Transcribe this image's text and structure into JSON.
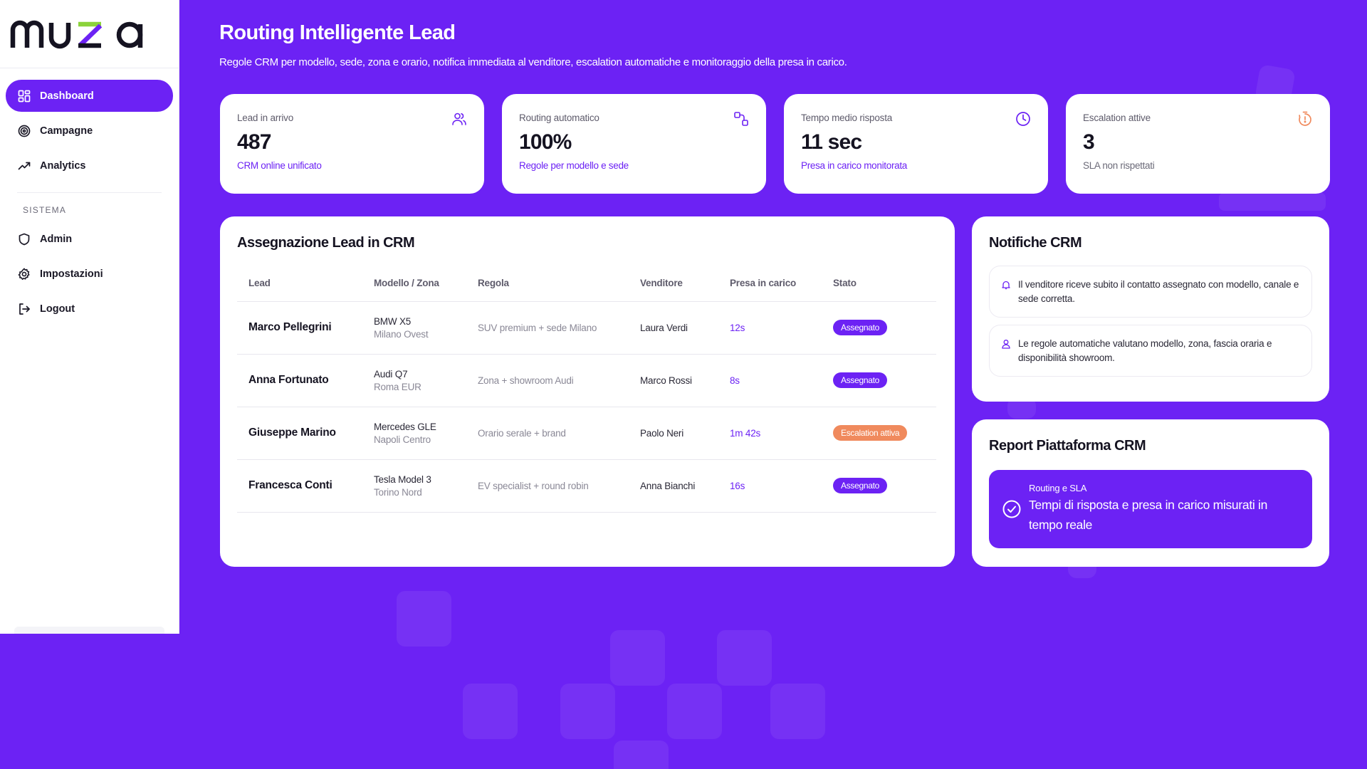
{
  "brand": {
    "name": "muza",
    "primary": "#6c22f4",
    "accent_green": "#8bd33a",
    "warning": "#f08a5d"
  },
  "sidebar": {
    "items": [
      {
        "label": "Dashboard",
        "icon": "grid-icon",
        "active": true
      },
      {
        "label": "Campagne",
        "icon": "target-icon",
        "active": false
      },
      {
        "label": "Analytics",
        "icon": "trend-icon",
        "active": false
      }
    ],
    "section_label": "SISTEMA",
    "system_items": [
      {
        "label": "Admin",
        "icon": "shield-icon"
      },
      {
        "label": "Impostazioni",
        "icon": "gear-icon"
      },
      {
        "label": "Logout",
        "icon": "logout-icon"
      }
    ]
  },
  "header": {
    "title": "Routing Intelligente Lead",
    "subtitle": "Regole CRM per modello, sede, zona e orario, notifica immediata al venditore, escalation automatiche e monitoraggio della presa in carico."
  },
  "stats": [
    {
      "label": "Lead in arrivo",
      "value": "487",
      "sub": "CRM online unificato",
      "icon": "users-icon"
    },
    {
      "label": "Routing automatico",
      "value": "100%",
      "sub": "Regole per modello e sede",
      "icon": "route-icon"
    },
    {
      "label": "Tempo medio risposta",
      "value": "11 sec",
      "sub": "Presa in carico monitorata",
      "icon": "clock-icon"
    },
    {
      "label": "Escalation attive",
      "value": "3",
      "sub": "SLA non rispettati",
      "icon": "timer-alert-icon"
    }
  ],
  "assignment": {
    "title": "Assegnazione Lead in CRM",
    "columns": [
      "Lead",
      "Modello / Zona",
      "Regola",
      "Venditore",
      "Presa in carico",
      "Stato"
    ],
    "rows": [
      {
        "lead": "Marco Pellegrini",
        "model": "BMW X5",
        "zone": "Milano Ovest",
        "rule": "SUV premium + sede Milano",
        "seller": "Laura Verdi",
        "taken": "12s",
        "status": "Assegnato"
      },
      {
        "lead": "Anna Fortunato",
        "model": "Audi Q7",
        "zone": "Roma EUR",
        "rule": "Zona + showroom Audi",
        "seller": "Marco Rossi",
        "taken": "8s",
        "status": "Assegnato"
      },
      {
        "lead": "Giuseppe Marino",
        "model": "Mercedes GLE",
        "zone": "Napoli Centro",
        "rule": "Orario serale + brand",
        "seller": "Paolo Neri",
        "taken": "1m 42s",
        "status": "Escalation attiva"
      },
      {
        "lead": "Francesca Conti",
        "model": "Tesla Model 3",
        "zone": "Torino Nord",
        "rule": "EV specialist + round robin",
        "seller": "Anna Bianchi",
        "taken": "16s",
        "status": "Assegnato"
      }
    ]
  },
  "notifications": {
    "title": "Notifiche CRM",
    "items": [
      {
        "text": "Il venditore riceve subito il contatto assegnato con modello, canale e sede corretta.",
        "icon": "bell-icon"
      },
      {
        "text": "Le regole automatiche valutano modello, zona, fascia oraria e disponibilità showroom.",
        "icon": "user-icon"
      }
    ]
  },
  "report": {
    "title": "Report Piattaforma CRM",
    "kicker": "Routing e SLA",
    "text": "Tempi di risposta e presa in carico misurati in tempo reale",
    "icon": "check-circle-icon"
  }
}
